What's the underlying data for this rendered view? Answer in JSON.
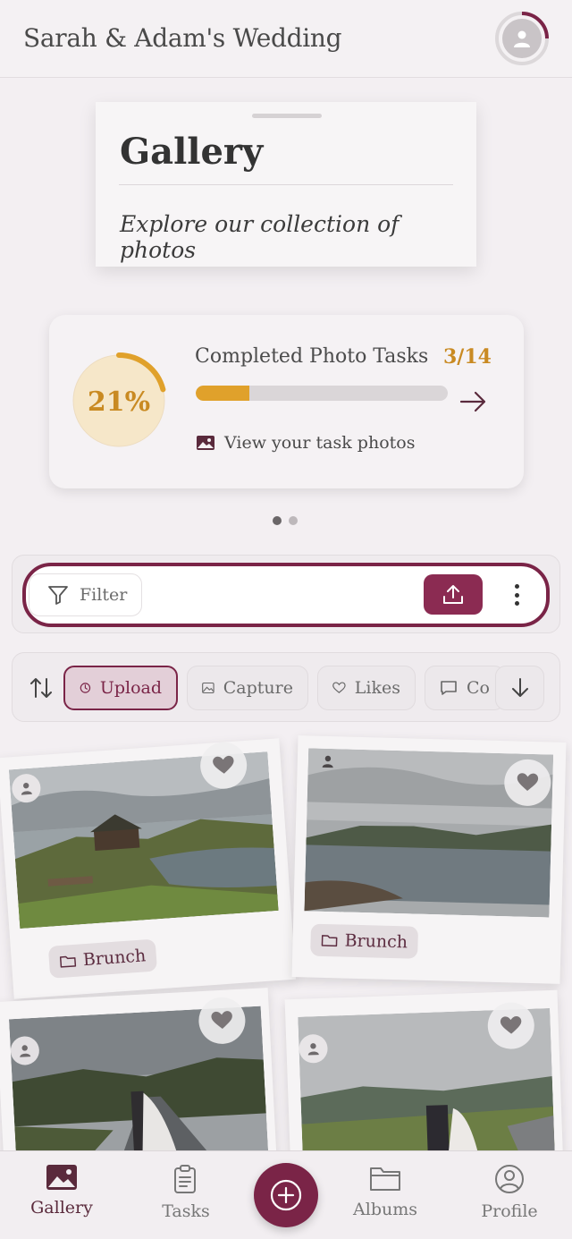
{
  "header": {
    "title": "Sarah & Adam's Wedding",
    "avatar_icon": "user-icon"
  },
  "gallery": {
    "title": "Gallery",
    "subtitle": "Explore our collection of photos"
  },
  "progress": {
    "percent_label": "21%",
    "percent": 21,
    "task_label": "Completed Photo Tasks",
    "count": "3/14",
    "fraction": 0.214,
    "link_label": "View your task photos",
    "accent": "#c98a22"
  },
  "carousel": {
    "pages": 2,
    "active": 1
  },
  "filter_bar": {
    "filter_label": "Filter",
    "upload_icon": "upload-icon",
    "more_icon": "more-vertical-icon"
  },
  "sort_chips": [
    {
      "label": "Upload",
      "icon": "clock-icon",
      "active": true
    },
    {
      "label": "Capture",
      "icon": "image-icon",
      "active": false
    },
    {
      "label": "Likes",
      "icon": "heart-icon",
      "active": false
    },
    {
      "label": "Co",
      "icon": "comment-icon",
      "active": false
    }
  ],
  "photos": [
    {
      "album": "Brunch"
    },
    {
      "album": "Brunch"
    },
    {
      "album": ""
    },
    {
      "album": ""
    }
  ],
  "nav": {
    "items": [
      {
        "label": "Gallery",
        "icon": "image-icon",
        "active": true
      },
      {
        "label": "Tasks",
        "icon": "clipboard-icon",
        "active": false
      },
      {
        "label": "Albums",
        "icon": "folder-icon",
        "active": false
      },
      {
        "label": "Profile",
        "icon": "user-circle-icon",
        "active": false
      }
    ]
  },
  "colors": {
    "brand": "#7a2447",
    "accent": "#e0a12b"
  }
}
